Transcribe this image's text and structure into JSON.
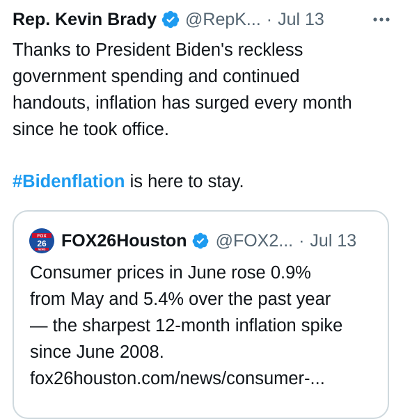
{
  "tweet": {
    "author_name": "Rep. Kevin Brady",
    "handle": "@RepK...",
    "separator": "·",
    "time": "Jul 13",
    "body": "Thanks to President Biden's reckless\ngovernment spending and continued\nhandouts, inflation has surged every month\nsince he took office.",
    "hashtag": "#Bidenflation",
    "tail": " is here to stay.",
    "more_icon": "more-horizontal-icon",
    "verified_icon": "verified-badge-icon"
  },
  "quote": {
    "avatar_text_top": "FOX",
    "avatar_text_mid": "26",
    "avatar_text_bot": "NEWS",
    "author_name": "FOX26Houston",
    "handle": "@FOX2...",
    "separator": "·",
    "time": "Jul 13",
    "body": "Consumer prices in June rose 0.9%\nfrom May and 5.4% over the past year\n— the sharpest 12-month inflation spike\nsince June 2008.\nfox26houston.com/news/consumer-..."
  },
  "colors": {
    "accent": "#1d9bf0",
    "text": "#0f1419",
    "secondary": "#536471",
    "border": "#cfd9de"
  }
}
